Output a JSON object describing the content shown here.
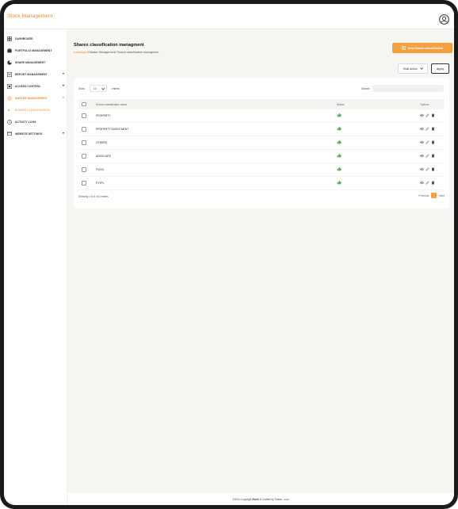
{
  "app": {
    "brand": "Stock Management"
  },
  "sidebar": {
    "items": [
      {
        "label": "DASHBOARD",
        "icon": "dashboard-icon"
      },
      {
        "label": "PORTFOLIO MANAGEMENT",
        "icon": "portfolio-icon"
      },
      {
        "label": "SHARE MANAGEMENT",
        "icon": "pie-chart-icon"
      },
      {
        "label": "REPORT MANAGEMENT",
        "icon": "report-icon"
      },
      {
        "label": "ACCESS CONTROL",
        "icon": "access-control-icon"
      },
      {
        "label": "MASTER MANAGEMENT",
        "icon": "gear-icon"
      },
      {
        "label": "SHARES CLASSIFICATION",
        "icon": "dot-icon"
      },
      {
        "label": "ACTIVITY LOGS",
        "icon": "activity-icon"
      },
      {
        "label": "WEBSITE SETTINGS",
        "icon": "website-settings-icon"
      }
    ]
  },
  "header": {
    "title": "Shares classification managment",
    "breadcrumb_link": "Dashboard",
    "breadcrumb_rest": "/ Master Management/ Shares classification managment",
    "new_button": "New Shares classification"
  },
  "toolbar": {
    "bulk_action": "Bulk action",
    "apply": "Apply"
  },
  "table": {
    "show_label": "Show",
    "page_size": "10",
    "entries_label": "entries",
    "search_label": "Search:",
    "columns": {
      "name": "Shares classification name",
      "status": "Status",
      "options": "Options"
    },
    "rows": [
      {
        "name": "PROPERTY"
      },
      {
        "name": "PROPERTY INVESTMENT"
      },
      {
        "name": "OTHERS"
      },
      {
        "name": "ASSOCIATE"
      },
      {
        "name": "FVOCI"
      },
      {
        "name": "FVTPL"
      }
    ],
    "info": "Showing 1 to 6 of 6 entries",
    "pagination": {
      "previous": "Previous",
      "current": "1",
      "next": "Next"
    }
  },
  "footer": {
    "copyright": "©2024 Copyright",
    "brand": "Stock",
    "crafted": "& Crafted by Tristan...com"
  },
  "colors": {
    "accent": "#f08a24",
    "button": "#f7a042",
    "status_green": "#4caf50"
  }
}
